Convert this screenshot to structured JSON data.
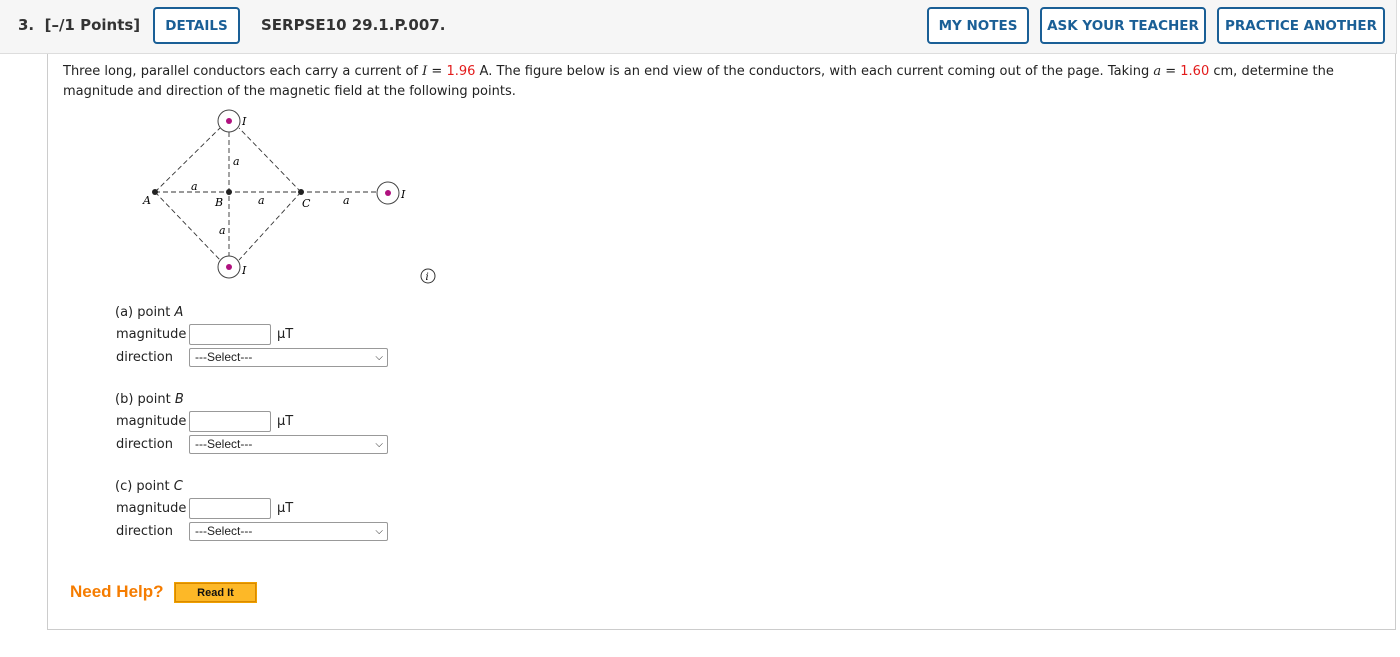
{
  "header": {
    "question_number": "3.",
    "points": "[–/1 Points]",
    "details_label": "DETAILS",
    "problem_code": "SERPSE10 29.1.P.007.",
    "my_notes_label": "MY NOTES",
    "ask_teacher_label": "ASK YOUR TEACHER",
    "practice_another_label": "PRACTICE ANOTHER"
  },
  "problem": {
    "text1": "Three long, parallel conductors each carry a current of ",
    "var_I": "I",
    "eq1": " = ",
    "current_value": "1.96",
    "text2": " A. The figure below is an end view of the conductors, with each current coming out of the page. Taking ",
    "var_a": "a",
    "eq2": " = ",
    "a_value": "1.60",
    "text3": " cm, determine the magnitude and direction of the magnetic field at the following points."
  },
  "figure": {
    "current_label": "I",
    "distance_label": "a",
    "points": [
      "A",
      "B",
      "C"
    ],
    "dot_color": "#b0117f"
  },
  "parts": [
    {
      "prefix": "(a) point ",
      "point": "A",
      "magnitude_label": "magnitude",
      "unit": "µT",
      "direction_label": "direction",
      "select_value": "---Select---",
      "magnitude_value": ""
    },
    {
      "prefix": "(b) point ",
      "point": "B",
      "magnitude_label": "magnitude",
      "unit": "µT",
      "direction_label": "direction",
      "select_value": "---Select---",
      "magnitude_value": ""
    },
    {
      "prefix": "(c) point ",
      "point": "C",
      "magnitude_label": "magnitude",
      "unit": "µT",
      "direction_label": "direction",
      "select_value": "---Select---",
      "magnitude_value": ""
    }
  ],
  "help": {
    "label": "Need Help?",
    "read_it_label": "Read It"
  },
  "colors": {
    "accent": "#1a5f96",
    "value_red": "#e21b1b",
    "help_orange": "#f57c00"
  }
}
